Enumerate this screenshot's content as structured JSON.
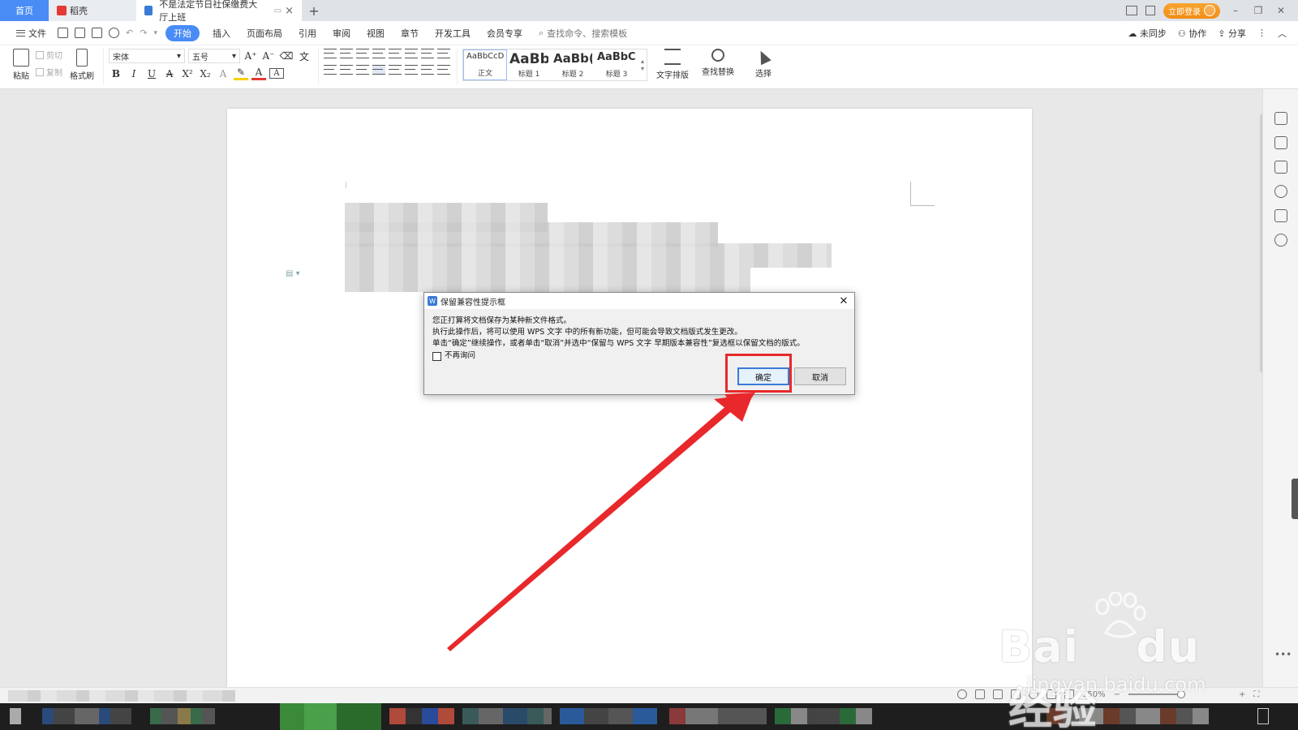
{
  "tabs": {
    "home": "首页",
    "wps": "稻壳",
    "doc": "不是法定节日社保缴费大厅上班"
  },
  "titlebar": {
    "login": "立即登录"
  },
  "menu": {
    "file": "文件",
    "items": [
      "开始",
      "插入",
      "页面布局",
      "引用",
      "审阅",
      "视图",
      "章节",
      "开发工具",
      "会员专享"
    ],
    "search_placeholder": "查找命令、搜索模板",
    "sync": "未同步",
    "collab": "协作",
    "share": "分享"
  },
  "ribbon": {
    "paste": "粘贴",
    "cut": "剪切",
    "copy": "复制",
    "format_painter": "格式刷",
    "font_name": "宋体",
    "font_size": "五号",
    "format_buttons": [
      "B",
      "I",
      "U",
      "A",
      "X²",
      "X₂",
      "A",
      "A"
    ],
    "styles": [
      {
        "sample": "AaBbCcDd",
        "name": "正文"
      },
      {
        "sample": "AaBb",
        "name": "标题 1"
      },
      {
        "sample": "AaBb(",
        "name": "标题 2"
      },
      {
        "sample": "AaBbC(",
        "name": "标题 3"
      }
    ],
    "text_layout": "文字排版",
    "find_replace": "查找替换",
    "select": "选择"
  },
  "dialog": {
    "title": "保留兼容性提示框",
    "line1": "您正打算将文档保存为某种新文件格式。",
    "line2": "执行此操作后，将可以使用 WPS 文字 中的所有新功能，但可能会导致文档版式发生更改。",
    "line3": "单击“确定”继续操作，或者单击“取消”并选中“保留与 WPS 文字 早期版本兼容性”复选框以保留文档的版式。",
    "checkbox": "不再询问",
    "ok": "确定",
    "cancel": "取消"
  },
  "status": {
    "zoom": "150%"
  },
  "watermark": {
    "brand": "Bai",
    "brand2": "du",
    "cn": "经验",
    "url": "jingyan.baidu.com"
  },
  "colors": {
    "accent": "#4a8cf6",
    "highlight": "#e8282b",
    "login": "#f28c13"
  }
}
